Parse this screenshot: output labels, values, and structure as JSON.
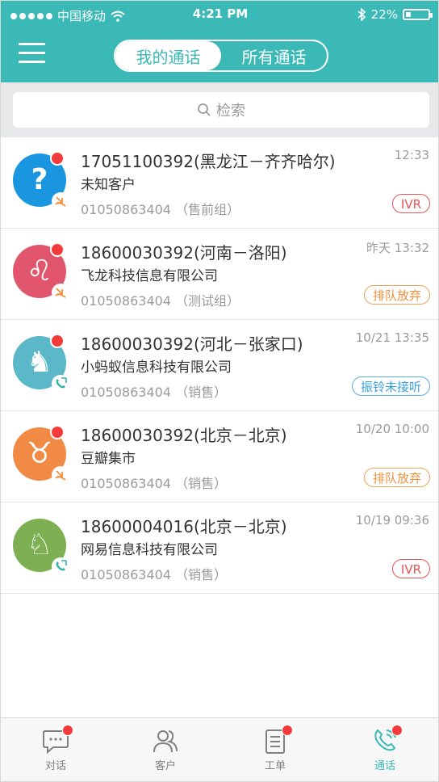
{
  "status_bar": {
    "carrier": "中国移动",
    "time": "4:21 PM",
    "battery": "22%",
    "battery_level": 0.22
  },
  "header": {
    "segments": [
      {
        "label": "我的通话",
        "active": true
      },
      {
        "label": "所有通话",
        "active": false
      }
    ]
  },
  "search": {
    "placeholder": "检索"
  },
  "calls": [
    {
      "phone": "17051100392(黑龙江－齐齐哈尔)",
      "company": "未知客户",
      "extension": "01050863404 （售前组）",
      "time": "12:33",
      "badge": "IVR",
      "badge_style": "red",
      "avatar_color": "#1a96e1",
      "avatar_glyph": "?",
      "avatar_icon": "question-icon",
      "call_icon": "missed-call-icon",
      "unread": true
    },
    {
      "phone": "18600030392(河南－洛阳)",
      "company": "飞龙科技信息有限公司",
      "extension": "01050863404 （测试组）",
      "time": "昨天 13:32",
      "badge": "排队放弃",
      "badge_style": "orange",
      "avatar_color": "#e2566d",
      "avatar_glyph": "♌",
      "avatar_icon": "lion-icon",
      "call_icon": "missed-call-icon",
      "unread": true
    },
    {
      "phone": "18600030392(河北－张家口)",
      "company": "小蚂蚁信息科技有限公司",
      "extension": "01050863404 （销售）",
      "time": "10/21 13:35",
      "badge": "振铃未接听",
      "badge_style": "blue",
      "avatar_color": "#5bb8c9",
      "avatar_glyph": "♞",
      "avatar_icon": "deer-icon",
      "call_icon": "incoming-call-icon",
      "unread": true
    },
    {
      "phone": "18600030392(北京－北京)",
      "company": "豆瓣集市",
      "extension": "01050863404 （销售）",
      "time": "10/20 10:00",
      "badge": "排队放弃",
      "badge_style": "orange",
      "avatar_color": "#f08a44",
      "avatar_glyph": "♉",
      "avatar_icon": "animal-icon",
      "call_icon": "missed-call-icon",
      "unread": true
    },
    {
      "phone": "18600004016(北京－北京)",
      "company": "网易信息科技有限公司",
      "extension": "01050863404 （销售）",
      "time": "10/19 09:36",
      "badge": "IVR",
      "badge_style": "red",
      "avatar_color": "#7db052",
      "avatar_glyph": "♘",
      "avatar_icon": "horse-icon",
      "call_icon": "incoming-call-icon",
      "unread": false
    }
  ],
  "tabs": [
    {
      "label": "对话",
      "icon": "chat-icon",
      "dot": true,
      "active": false
    },
    {
      "label": "客户",
      "icon": "customers-icon",
      "dot": false,
      "active": false
    },
    {
      "label": "工单",
      "icon": "ticket-icon",
      "dot": true,
      "active": false
    },
    {
      "label": "通话",
      "icon": "phone-icon",
      "dot": true,
      "active": true
    }
  ],
  "colors": {
    "accent": "#3bb9b6",
    "unread_dot": "#f43b3b",
    "badge_red": "#e55454",
    "badge_orange": "#f0903a",
    "badge_blue": "#3a9fe0"
  }
}
